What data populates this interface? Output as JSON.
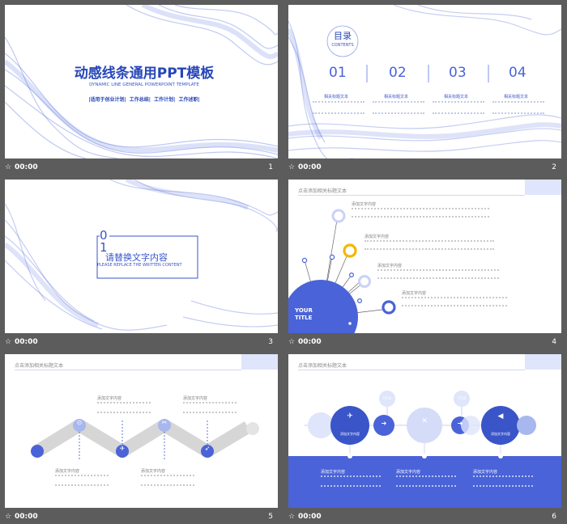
{
  "slides": [
    {
      "number": "1",
      "time": "00:00",
      "title": "动感线条通用PPT模板",
      "subtitle": "DYNAMIC LINE GENERAL POWERPOINT TEMPLATE",
      "tags": "|适用于创业计划|  工作总结|  工作计划|  工作述职|"
    },
    {
      "number": "2",
      "time": "00:00",
      "toc_title": "目录",
      "toc_sub": "CONTENTS",
      "items": [
        {
          "num": "01",
          "label": "相关标题文本"
        },
        {
          "num": "02",
          "label": "相关标题文本"
        },
        {
          "num": "03",
          "label": "相关标题文本"
        },
        {
          "num": "04",
          "label": "相关标题文本"
        }
      ]
    },
    {
      "number": "3",
      "time": "00:00",
      "section_num": "01",
      "section_title": "请替换文字内容",
      "section_sub": "PLEASE REPLACE THE WRITTEN CONTENT"
    },
    {
      "number": "4",
      "time": "00:00",
      "header": "点击添加相关标题文本",
      "badge_line1": "YOUR",
      "badge_line2": "TITLE",
      "entries": [
        "添加文字内容",
        "添加文字内容",
        "添加文字内容",
        "添加文字内容"
      ]
    },
    {
      "number": "5",
      "time": "00:00",
      "header": "点击添加相关标题文本",
      "entries": [
        "添加文字内容",
        "添加文字内容",
        "添加文字内容",
        "添加文字内容"
      ]
    },
    {
      "number": "6",
      "time": "00:00",
      "header": "点击添加相关标题文本",
      "bubble_small": "TITLE",
      "bubble_labels": [
        "添加文字内容",
        "添加文字内容"
      ],
      "entries": [
        "添加文字内容",
        "添加文字内容",
        "添加文字内容"
      ]
    }
  ],
  "colors": {
    "accent": "#3a55c8",
    "accent_light": "#7d93e8",
    "pale": "#dfe5fa",
    "yellow": "#f2b705",
    "background": "#5c5c5c"
  }
}
